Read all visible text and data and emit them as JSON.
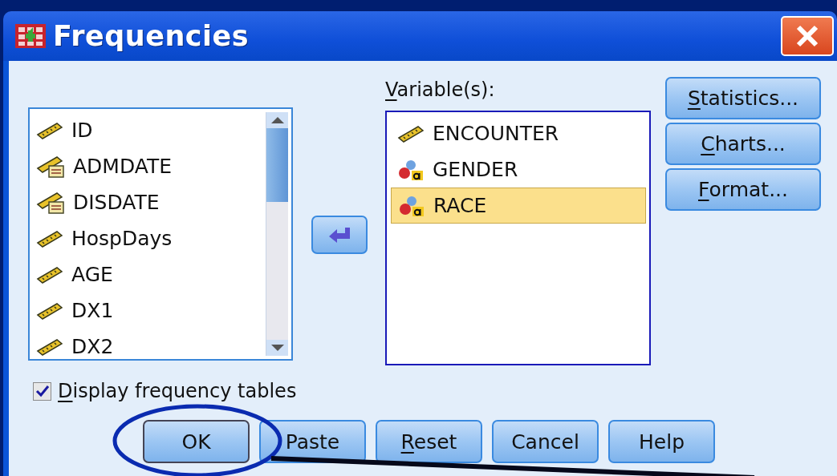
{
  "window": {
    "title": "Frequencies"
  },
  "source_variables": [
    {
      "name": "ID",
      "kind": "scale"
    },
    {
      "name": "ADMDATE",
      "kind": "date"
    },
    {
      "name": "DISDATE",
      "kind": "date"
    },
    {
      "name": "HospDays",
      "kind": "scale"
    },
    {
      "name": "AGE",
      "kind": "scale"
    },
    {
      "name": "DX1",
      "kind": "scale"
    },
    {
      "name": "DX2",
      "kind": "scale"
    }
  ],
  "target": {
    "label_key": "V",
    "label_rest": "ariable(s):",
    "variables": [
      {
        "name": "ENCOUNTER",
        "kind": "scale",
        "selected": false
      },
      {
        "name": "GENDER",
        "kind": "nominal",
        "selected": false
      },
      {
        "name": "RACE",
        "kind": "nominal",
        "selected": true
      }
    ]
  },
  "side_buttons": [
    {
      "key": "S",
      "rest": "tatistics..."
    },
    {
      "key": "C",
      "rest": "harts..."
    },
    {
      "key": "F",
      "rest": "ormat..."
    }
  ],
  "display_frequency_tables": {
    "key": "D",
    "rest": "isplay frequency tables",
    "checked": true
  },
  "bottom_buttons": [
    {
      "rest": "OK"
    },
    {
      "rest": "Paste"
    },
    {
      "key": "R",
      "rest": "eset"
    },
    {
      "rest": "Cancel"
    },
    {
      "rest": "Help"
    }
  ]
}
